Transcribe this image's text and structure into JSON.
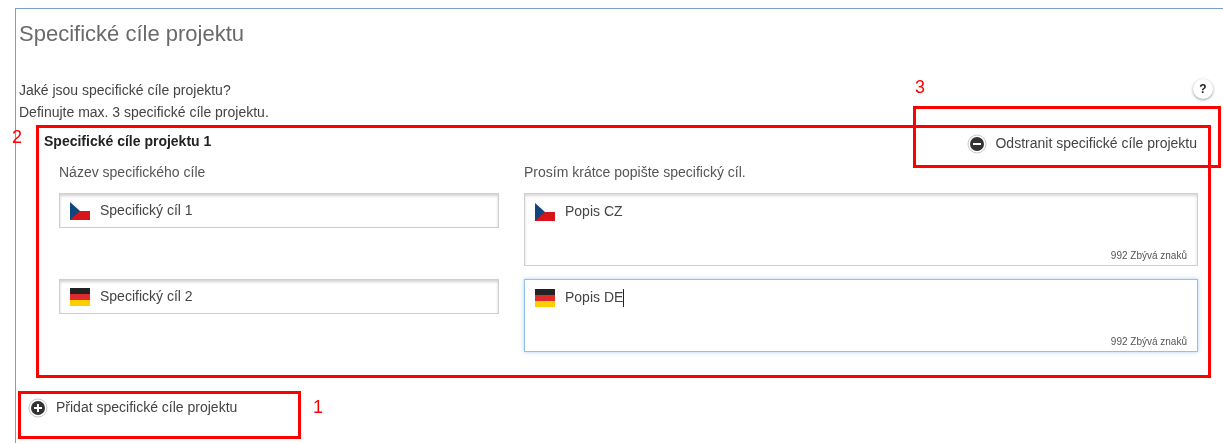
{
  "panel": {
    "title": "Specifické cíle projektu",
    "question": "Jaké jsou specifické cíle projektu?",
    "hint": "Definujte max. 3 specifické cíle projektu.",
    "help": "?"
  },
  "objective": {
    "title": "Specifické cíle projektu 1",
    "remove_button": "Odstranit specifické cíle projektu",
    "name_label": "Název specifického cíle",
    "description_label": "Prosím krátce popište specifický cíl.",
    "rows": [
      {
        "kind": "cz",
        "name": "Specifický cíl 1",
        "description": "Popis CZ",
        "counter": "992 Zbývá znaků",
        "focused": false
      },
      {
        "kind": "de",
        "name": "Specifický cíl 2",
        "description": "Popis DE",
        "counter": "992 Zbývá znaků",
        "focused": true
      }
    ]
  },
  "add_button": "Přidat specifické cíle projektu",
  "annotations": [
    {
      "number": "3"
    },
    {
      "number": "2"
    },
    {
      "number": "1"
    }
  ]
}
